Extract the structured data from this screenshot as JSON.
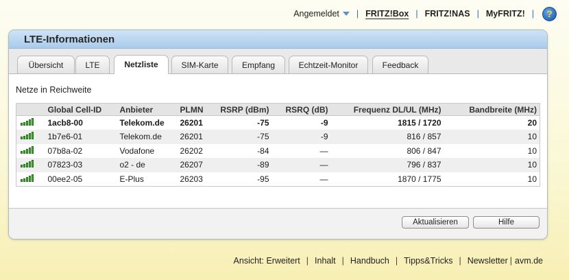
{
  "topnav": {
    "login_label": "Angemeldet",
    "links": [
      "FRITZ!Box",
      "FRITZ!NAS",
      "MyFRITZ!"
    ],
    "help_symbol": "?"
  },
  "panel": {
    "title": "LTE-Informationen",
    "tabs": [
      {
        "label": "Übersicht",
        "active": false
      },
      {
        "label": "LTE",
        "active": false
      },
      {
        "label": "Netzliste",
        "active": true
      },
      {
        "label": "SIM-Karte",
        "active": false
      },
      {
        "label": "Empfang",
        "active": false
      },
      {
        "label": "Echtzeit-Monitor",
        "active": false
      },
      {
        "label": "Feedback",
        "active": false
      }
    ],
    "section_title": "Netze in Reichweite",
    "table": {
      "headers": [
        "",
        "Global Cell-ID",
        "Anbieter",
        "PLMN",
        "RSRP (dBm)",
        "RSRQ (dB)",
        "Frequenz DL/UL (MHz)",
        "Bandbreite (MHz)"
      ],
      "rows": [
        {
          "signal_bars": 5,
          "cell_id": "1acb8-00",
          "provider": "Telekom.de",
          "plmn": "26201",
          "rsrp": "-75",
          "rsrq": "-9",
          "freq": "1815 / 1720",
          "bandwidth": "20"
        },
        {
          "signal_bars": 5,
          "cell_id": "1b7e6-01",
          "provider": "Telekom.de",
          "plmn": "26201",
          "rsrp": "-75",
          "rsrq": "-9",
          "freq": "816 / 857",
          "bandwidth": "10"
        },
        {
          "signal_bars": 5,
          "cell_id": "07b8a-02",
          "provider": "Vodafone",
          "plmn": "26202",
          "rsrp": "-84",
          "rsrq": "—",
          "freq": "806 / 847",
          "bandwidth": "10"
        },
        {
          "signal_bars": 5,
          "cell_id": "07823-03",
          "provider": "o2 - de",
          "plmn": "26207",
          "rsrp": "-89",
          "rsrq": "—",
          "freq": "796 / 837",
          "bandwidth": "10"
        },
        {
          "signal_bars": 5,
          "cell_id": "00ee2-05",
          "provider": "E-Plus",
          "plmn": "26203",
          "rsrp": "-95",
          "rsrq": "—",
          "freq": "1870 / 1775",
          "bandwidth": "10"
        }
      ]
    },
    "buttons": {
      "refresh": "Aktualisieren",
      "help": "Hilfe"
    }
  },
  "bottomnav": {
    "links": [
      "Ansicht: Erweitert",
      "Inhalt",
      "Handbuch",
      "Tipps&Tricks",
      "Newsletter",
      "avm.de"
    ]
  },
  "colors": {
    "accent": "#1f6fb2",
    "header": "#a9cbeb",
    "signal": "#49b82e"
  }
}
